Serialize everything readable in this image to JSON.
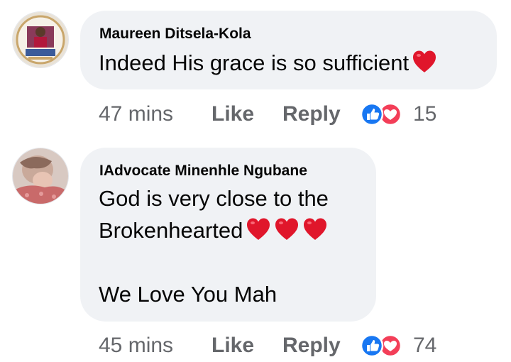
{
  "comments": [
    {
      "author": "Maureen Ditsela-Kola",
      "lines": [
        "Indeed His grace is so sufficient"
      ],
      "time": "47 mins",
      "like_label": "Like",
      "reply_label": "Reply",
      "reaction_count": "15",
      "reactions": [
        "like-icon",
        "love-icon"
      ]
    },
    {
      "author": "IAdvocate Minenhle Ngubane",
      "lines": [
        "God is very close to the",
        "Brokenhearted",
        "",
        "We Love You Mah"
      ],
      "time": "45 mins",
      "like_label": "Like",
      "reply_label": "Reply",
      "reaction_count": "74",
      "reactions": [
        "like-icon",
        "love-icon"
      ]
    }
  ],
  "colors": {
    "bubble": "#f0f2f5",
    "meta_text": "#65676b",
    "like_blue": "#1877f2",
    "love_red": "#f33e58",
    "heart_red": "#e0162b"
  }
}
